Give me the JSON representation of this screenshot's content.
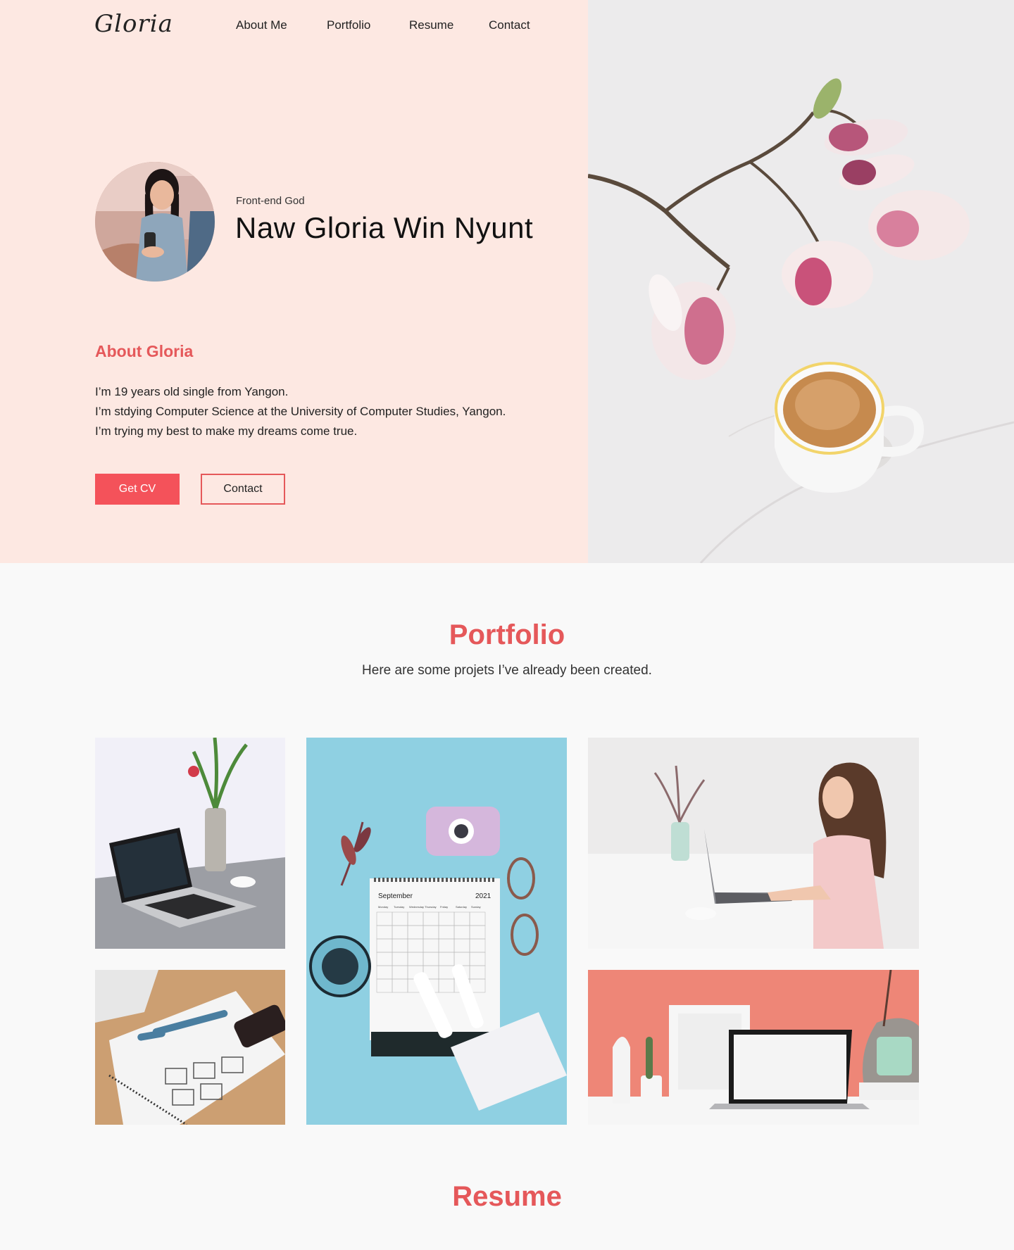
{
  "header": {
    "logo": "Gloria",
    "nav": [
      "About Me",
      "Portfolio",
      "Resume",
      "Contact"
    ]
  },
  "hero": {
    "role": "Front-end God",
    "name": "Naw Gloria Win Nyunt"
  },
  "about": {
    "title": "About Gloria",
    "lines": [
      "I’m 19 years old single from Yangon.",
      "I’m stdying Computer Science at the University of Computer Studies, Yangon.",
      "I’m trying my best to make my dreams come true."
    ],
    "buttons": {
      "cv": "Get CV",
      "contact": "Contact"
    }
  },
  "portfolio": {
    "title": "Portfolio",
    "subtitle": "Here are some projets I’ve already been created.",
    "calendar": {
      "month": "September",
      "year": "2021",
      "days": [
        "Monday",
        "Tuesday",
        "Wednesday",
        "Thursday",
        "Friday",
        "Saturday",
        "Sunday"
      ]
    }
  },
  "resume": {
    "title": "Resume"
  },
  "colors": {
    "accent": "#e5585a",
    "button": "#f4525a",
    "hero_bg": "#fde8e2",
    "page_bg": "#f9f9f9"
  }
}
